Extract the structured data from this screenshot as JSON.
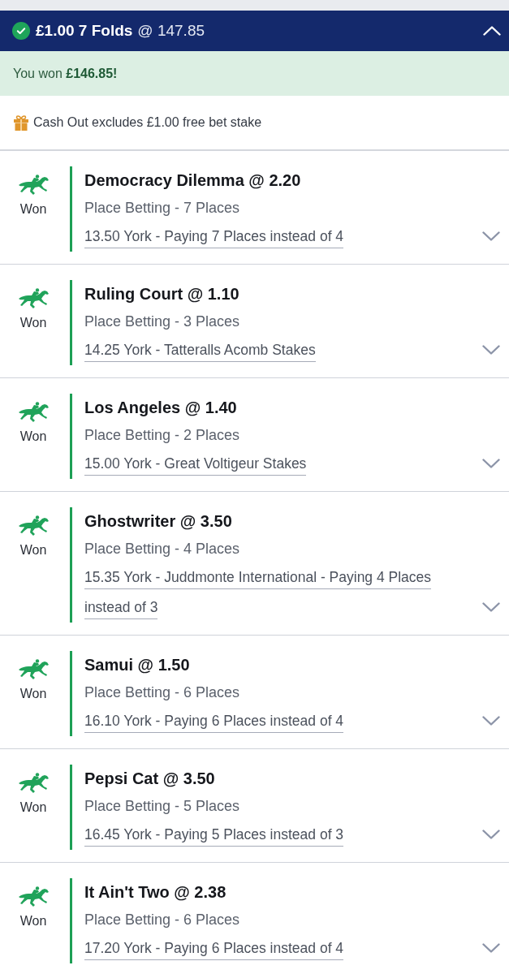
{
  "bet": {
    "title": "£1.00 7 Folds",
    "odds": "@ 147.85",
    "expanded": true
  },
  "result_banner": {
    "text": "You won **£146.85!**"
  },
  "notice": {
    "text": "Cash Out excludes £1.00 free bet stake"
  },
  "legs": [
    {
      "status": "Won",
      "selection": "Democracy Dilemma @ 2.20",
      "market": "Place Betting - 7 Places",
      "event_lines": [
        "13.50 York - Paying 7 Places instead of 4"
      ],
      "expanded": false
    },
    {
      "status": "Won",
      "selection": "Ruling Court @ 1.10",
      "market": "Place Betting - 3 Places",
      "event_lines": [
        "14.25 York - Tatteralls Acomb Stakes"
      ],
      "expanded": false
    },
    {
      "status": "Won",
      "selection": "Los Angeles @ 1.40",
      "market": "Place Betting - 2 Places",
      "event_lines": [
        "15.00 York - Great Voltigeur Stakes"
      ],
      "expanded": false
    },
    {
      "status": "Won",
      "selection": "Ghostwriter @ 3.50",
      "market": "Place Betting - 4 Places",
      "event_lines": [
        "15.35 York - Juddmonte International - Paying 4 Places",
        "instead of 3"
      ],
      "expanded": false
    },
    {
      "status": "Won",
      "selection": "Samui @ 1.50",
      "market": "Place Betting - 6 Places",
      "event_lines": [
        "16.10 York - Paying 6 Places instead of 4"
      ],
      "expanded": false
    },
    {
      "status": "Won",
      "selection": "Pepsi Cat @ 3.50",
      "market": "Place Betting - 5 Places",
      "event_lines": [
        "16.45 York - Paying 5 Places instead of 3"
      ],
      "expanded": false
    },
    {
      "status": "Won",
      "selection": "It Ain't Two @ 2.38",
      "market": "Place Betting - 6 Places",
      "event_lines": [
        "17.20 York - Paying 6 Places instead of 4"
      ],
      "expanded": false
    }
  ]
}
